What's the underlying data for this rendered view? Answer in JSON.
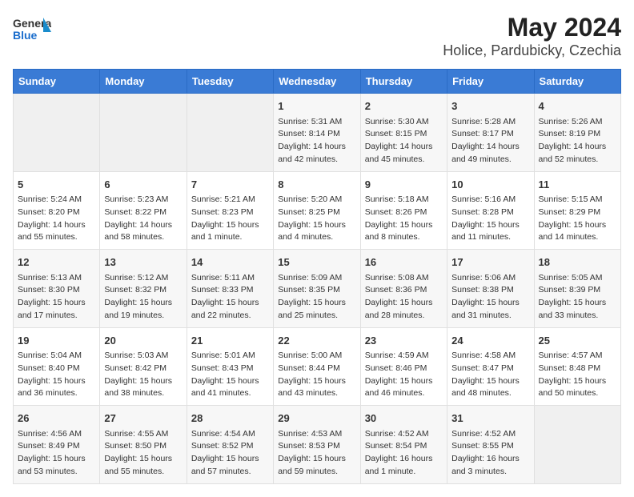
{
  "logo": {
    "line1": "General",
    "line2": "Blue"
  },
  "title": "May 2024",
  "subtitle": "Holice, Pardubicky, Czechia",
  "days_of_week": [
    "Sunday",
    "Monday",
    "Tuesday",
    "Wednesday",
    "Thursday",
    "Friday",
    "Saturday"
  ],
  "weeks": [
    [
      {
        "day": "",
        "empty": true
      },
      {
        "day": "",
        "empty": true
      },
      {
        "day": "",
        "empty": true
      },
      {
        "day": "1",
        "sunrise": "5:31 AM",
        "sunset": "8:14 PM",
        "daylight": "14 hours and 42 minutes."
      },
      {
        "day": "2",
        "sunrise": "5:30 AM",
        "sunset": "8:15 PM",
        "daylight": "14 hours and 45 minutes."
      },
      {
        "day": "3",
        "sunrise": "5:28 AM",
        "sunset": "8:17 PM",
        "daylight": "14 hours and 49 minutes."
      },
      {
        "day": "4",
        "sunrise": "5:26 AM",
        "sunset": "8:19 PM",
        "daylight": "14 hours and 52 minutes."
      }
    ],
    [
      {
        "day": "5",
        "sunrise": "5:24 AM",
        "sunset": "8:20 PM",
        "daylight": "14 hours and 55 minutes."
      },
      {
        "day": "6",
        "sunrise": "5:23 AM",
        "sunset": "8:22 PM",
        "daylight": "14 hours and 58 minutes."
      },
      {
        "day": "7",
        "sunrise": "5:21 AM",
        "sunset": "8:23 PM",
        "daylight": "15 hours and 1 minute."
      },
      {
        "day": "8",
        "sunrise": "5:20 AM",
        "sunset": "8:25 PM",
        "daylight": "15 hours and 4 minutes."
      },
      {
        "day": "9",
        "sunrise": "5:18 AM",
        "sunset": "8:26 PM",
        "daylight": "15 hours and 8 minutes."
      },
      {
        "day": "10",
        "sunrise": "5:16 AM",
        "sunset": "8:28 PM",
        "daylight": "15 hours and 11 minutes."
      },
      {
        "day": "11",
        "sunrise": "5:15 AM",
        "sunset": "8:29 PM",
        "daylight": "15 hours and 14 minutes."
      }
    ],
    [
      {
        "day": "12",
        "sunrise": "5:13 AM",
        "sunset": "8:30 PM",
        "daylight": "15 hours and 17 minutes."
      },
      {
        "day": "13",
        "sunrise": "5:12 AM",
        "sunset": "8:32 PM",
        "daylight": "15 hours and 19 minutes."
      },
      {
        "day": "14",
        "sunrise": "5:11 AM",
        "sunset": "8:33 PM",
        "daylight": "15 hours and 22 minutes."
      },
      {
        "day": "15",
        "sunrise": "5:09 AM",
        "sunset": "8:35 PM",
        "daylight": "15 hours and 25 minutes."
      },
      {
        "day": "16",
        "sunrise": "5:08 AM",
        "sunset": "8:36 PM",
        "daylight": "15 hours and 28 minutes."
      },
      {
        "day": "17",
        "sunrise": "5:06 AM",
        "sunset": "8:38 PM",
        "daylight": "15 hours and 31 minutes."
      },
      {
        "day": "18",
        "sunrise": "5:05 AM",
        "sunset": "8:39 PM",
        "daylight": "15 hours and 33 minutes."
      }
    ],
    [
      {
        "day": "19",
        "sunrise": "5:04 AM",
        "sunset": "8:40 PM",
        "daylight": "15 hours and 36 minutes."
      },
      {
        "day": "20",
        "sunrise": "5:03 AM",
        "sunset": "8:42 PM",
        "daylight": "15 hours and 38 minutes."
      },
      {
        "day": "21",
        "sunrise": "5:01 AM",
        "sunset": "8:43 PM",
        "daylight": "15 hours and 41 minutes."
      },
      {
        "day": "22",
        "sunrise": "5:00 AM",
        "sunset": "8:44 PM",
        "daylight": "15 hours and 43 minutes."
      },
      {
        "day": "23",
        "sunrise": "4:59 AM",
        "sunset": "8:46 PM",
        "daylight": "15 hours and 46 minutes."
      },
      {
        "day": "24",
        "sunrise": "4:58 AM",
        "sunset": "8:47 PM",
        "daylight": "15 hours and 48 minutes."
      },
      {
        "day": "25",
        "sunrise": "4:57 AM",
        "sunset": "8:48 PM",
        "daylight": "15 hours and 50 minutes."
      }
    ],
    [
      {
        "day": "26",
        "sunrise": "4:56 AM",
        "sunset": "8:49 PM",
        "daylight": "15 hours and 53 minutes."
      },
      {
        "day": "27",
        "sunrise": "4:55 AM",
        "sunset": "8:50 PM",
        "daylight": "15 hours and 55 minutes."
      },
      {
        "day": "28",
        "sunrise": "4:54 AM",
        "sunset": "8:52 PM",
        "daylight": "15 hours and 57 minutes."
      },
      {
        "day": "29",
        "sunrise": "4:53 AM",
        "sunset": "8:53 PM",
        "daylight": "15 hours and 59 minutes."
      },
      {
        "day": "30",
        "sunrise": "4:52 AM",
        "sunset": "8:54 PM",
        "daylight": "16 hours and 1 minute."
      },
      {
        "day": "31",
        "sunrise": "4:52 AM",
        "sunset": "8:55 PM",
        "daylight": "16 hours and 3 minutes."
      },
      {
        "day": "",
        "empty": true
      }
    ]
  ],
  "labels": {
    "sunrise": "Sunrise:",
    "sunset": "Sunset:",
    "daylight": "Daylight:"
  }
}
